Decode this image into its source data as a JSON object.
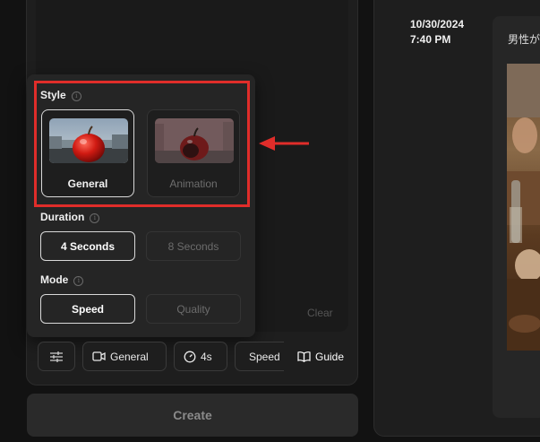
{
  "popup": {
    "style_title": "Style",
    "style_cards": [
      {
        "label": "General",
        "selected": true
      },
      {
        "label": "Animation",
        "selected": false
      }
    ],
    "duration_title": "Duration",
    "duration_options": [
      {
        "label": "4 Seconds",
        "selected": true
      },
      {
        "label": "8 Seconds",
        "selected": false
      }
    ],
    "mode_title": "Mode",
    "mode_options": [
      {
        "label": "Speed",
        "selected": true
      },
      {
        "label": "Quality",
        "selected": false
      }
    ],
    "info_icon": "info-icon"
  },
  "prompt": {
    "clear_label": "Clear"
  },
  "toolbar": {
    "settings_icon": "sliders-icon",
    "style_button": "General",
    "duration_button": "4s",
    "mode_button": "Speed",
    "guide_label": "Guide"
  },
  "create_button": "Create",
  "history": {
    "date": "10/30/2024",
    "time": "7:40 PM",
    "prompt_snippet": "男性が"
  },
  "colors": {
    "background": "#121212",
    "panel": "#1e1e1e",
    "highlight": "#e02d2a",
    "selected_border": "#d9d9d9"
  }
}
